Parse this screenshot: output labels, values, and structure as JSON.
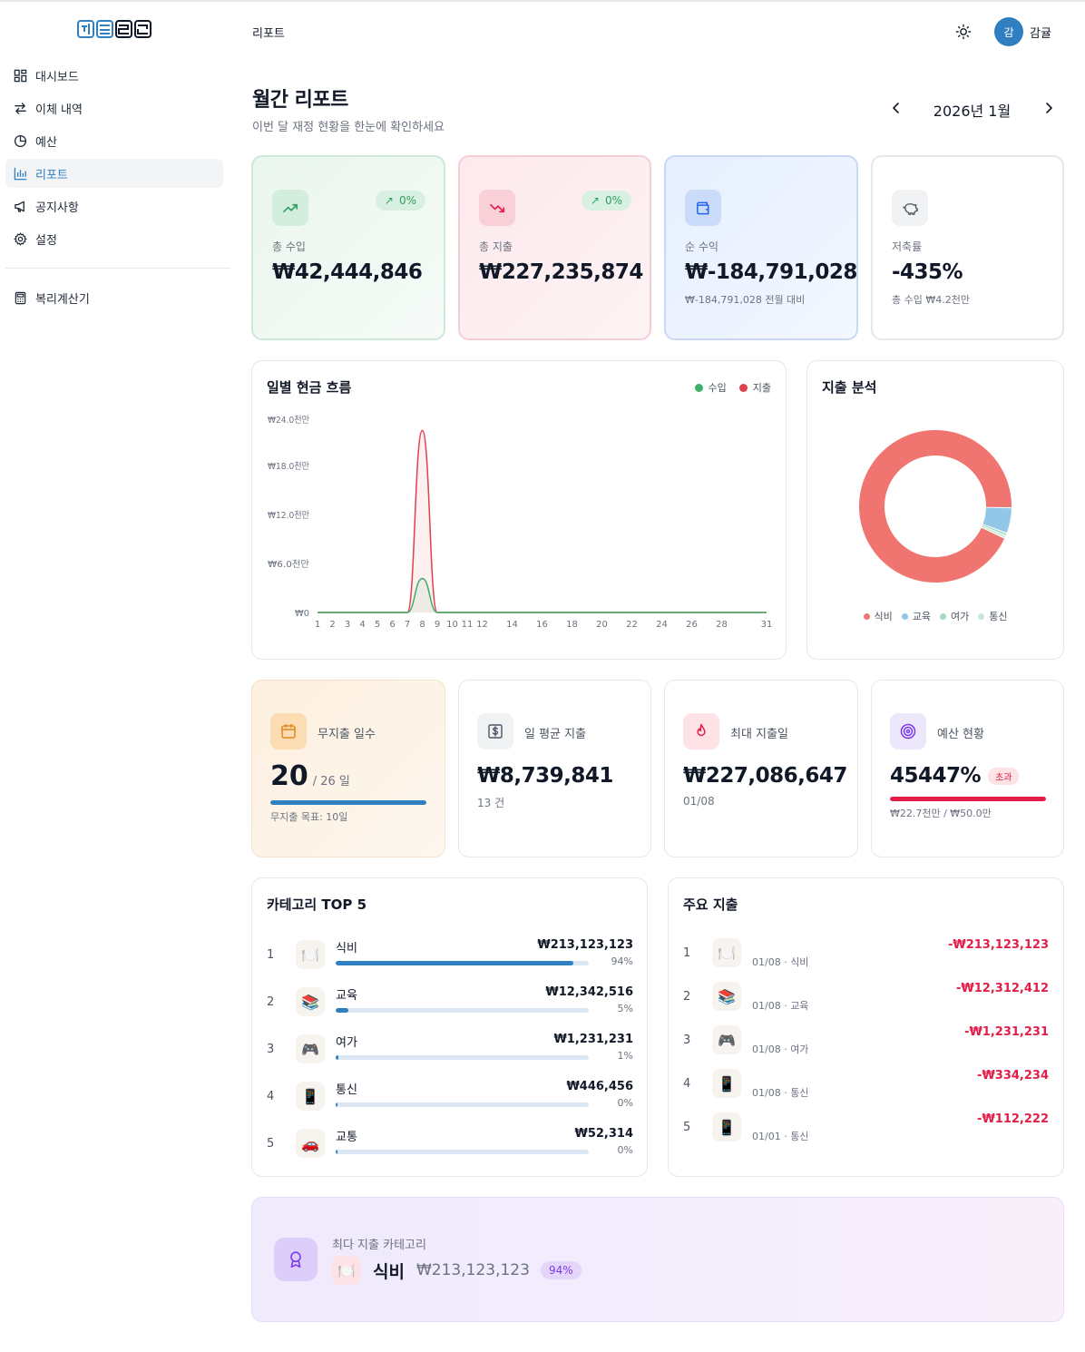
{
  "app": {
    "logo_text": "하루결산",
    "header_title": "리포트",
    "user_initial": "감",
    "user_name": "감귤"
  },
  "sidebar": {
    "items": [
      {
        "label": "대시보드",
        "icon": "dashboard-grid-icon"
      },
      {
        "label": "이체 내역",
        "icon": "transfer-arrows-icon"
      },
      {
        "label": "예산",
        "icon": "pie-chart-icon"
      },
      {
        "label": "리포트",
        "icon": "bar-chart-icon",
        "active": true
      },
      {
        "label": "공지사항",
        "icon": "megaphone-icon"
      },
      {
        "label": "설정",
        "icon": "gear-icon"
      }
    ],
    "tools": [
      {
        "label": "복리계산기",
        "icon": "calculator-icon"
      }
    ]
  },
  "page": {
    "title": "월간 리포트",
    "subtitle": "이번 달 재정 현황을 한눈에 확인하세요",
    "month_label": "2026년 1월"
  },
  "stats": {
    "income": {
      "label": "총 수입",
      "value": "₩42,444,846",
      "badge": "0%",
      "icon": "trending-up-icon"
    },
    "expense": {
      "label": "총 지출",
      "value": "₩227,235,874",
      "badge": "0%",
      "icon": "trending-down-icon"
    },
    "net": {
      "label": "순 수익",
      "value": "₩-184,791,028",
      "note": "₩-184,791,028 전월 대비",
      "icon": "wallet-icon"
    },
    "savings": {
      "label": "저축률",
      "value": "-435%",
      "note": "총 수입 ₩4.2천만",
      "icon": "piggy-bank-icon"
    }
  },
  "cashflow": {
    "title": "일별 현금 흐름",
    "legend": [
      "수입",
      "지출"
    ],
    "colors": {
      "income": "#3fae6a",
      "expense": "#e0414b"
    }
  },
  "chart_data": [
    {
      "type": "area",
      "title": "일별 현금 흐름",
      "x": [
        1,
        2,
        3,
        4,
        5,
        6,
        7,
        8,
        9,
        10,
        11,
        12,
        13,
        14,
        15,
        16,
        17,
        18,
        19,
        20,
        21,
        22,
        23,
        24,
        25,
        26,
        27,
        28,
        29,
        30,
        31
      ],
      "x_tick_labels": [
        "1",
        "2",
        "3",
        "4",
        "5",
        "6",
        "7",
        "8",
        "9",
        "10",
        "11",
        "12",
        "14",
        "16",
        "18",
        "20",
        "22",
        "24",
        "26",
        "28",
        "31"
      ],
      "y_tick_labels": [
        "₩0",
        "₩6.0천만",
        "₩18.0천만",
        "₩12.0천만",
        "₩24.0천만"
      ],
      "ylim": [
        0,
        240000000
      ],
      "series": [
        {
          "name": "수입",
          "color": "#3fae6a",
          "values": [
            0,
            0,
            0,
            0,
            0,
            0,
            0,
            42444846,
            0,
            0,
            0,
            0,
            0,
            0,
            0,
            0,
            0,
            0,
            0,
            0,
            0,
            0,
            0,
            0,
            0,
            0,
            0,
            0,
            0,
            0,
            0
          ]
        },
        {
          "name": "지출",
          "color": "#e0414b",
          "values": [
            0,
            0,
            0,
            0,
            0,
            0,
            0,
            227086647,
            0,
            0,
            0,
            0,
            0,
            0,
            0,
            0,
            0,
            0,
            0,
            0,
            0,
            0,
            0,
            0,
            0,
            0,
            0,
            0,
            0,
            0,
            0
          ]
        }
      ],
      "legend": "top-right",
      "grid": false
    },
    {
      "type": "pie",
      "title": "지출 분석",
      "categories": [
        "식비",
        "교육",
        "여가",
        "통신"
      ],
      "values": [
        213123123,
        12342516,
        1231231,
        446456
      ],
      "colors": [
        "#f0746f",
        "#93c7e8",
        "#a6d8bd",
        "#c3e8d3"
      ],
      "donut": true,
      "legend": "bottom"
    }
  ],
  "breakdown": {
    "title": "지출 분석",
    "legend": [
      {
        "label": "식비",
        "color": "#f0746f"
      },
      {
        "label": "교육",
        "color": "#93c7e8"
      },
      {
        "label": "여가",
        "color": "#a6d8bd"
      },
      {
        "label": "통신",
        "color": "#c3e8d3"
      }
    ]
  },
  "mini": {
    "no_spend": {
      "label": "무지출 일수",
      "value": "20",
      "suffix": "/ 26 일",
      "goal": "무지출 목표: 10일",
      "progress": 1.0,
      "icon": "calendar-icon"
    },
    "daily_avg": {
      "label": "일 평균 지출",
      "value": "₩8,739,841",
      "note": "13 건",
      "icon": "dollar-bill-icon"
    },
    "max_day": {
      "label": "최대 지출일",
      "value": "₩227,086,647",
      "note": "01/08",
      "icon": "flame-icon"
    },
    "budget": {
      "label": "예산 현황",
      "value": "45447%",
      "badge": "초과",
      "note": "₩22.7천만 / ₩50.0만",
      "progress": 1.0,
      "icon": "target-icon"
    }
  },
  "top5": {
    "title": "카테고리 TOP 5",
    "rows": [
      {
        "rank": "1",
        "emoji": "🍽️",
        "name": "식비",
        "amount": "₩213,123,123",
        "pct": "94%",
        "fraction": 0.94
      },
      {
        "rank": "2",
        "emoji": "📚",
        "name": "교육",
        "amount": "₩12,342,516",
        "pct": "5%",
        "fraction": 0.05
      },
      {
        "rank": "3",
        "emoji": "🎮",
        "name": "여가",
        "amount": "₩1,231,231",
        "pct": "1%",
        "fraction": 0.01
      },
      {
        "rank": "4",
        "emoji": "📱",
        "name": "통신",
        "amount": "₩446,456",
        "pct": "0%",
        "fraction": 0.0
      },
      {
        "rank": "5",
        "emoji": "🚗",
        "name": "교통",
        "amount": "₩52,314",
        "pct": "0%",
        "fraction": 0.0
      }
    ]
  },
  "major": {
    "title": "주요 지출",
    "rows": [
      {
        "rank": "1",
        "emoji": "🍽️",
        "meta": "01/08 · 식비",
        "amount": "-₩213,123,123"
      },
      {
        "rank": "2",
        "emoji": "📚",
        "meta": "01/08 · 교육",
        "amount": "-₩12,312,412"
      },
      {
        "rank": "3",
        "emoji": "🎮",
        "meta": "01/08 · 여가",
        "amount": "-₩1,231,231"
      },
      {
        "rank": "4",
        "emoji": "📱",
        "meta": "01/08 · 통신",
        "amount": "-₩334,234"
      },
      {
        "rank": "5",
        "emoji": "📱",
        "meta": "01/01 · 통신",
        "amount": "-₩112,222"
      }
    ]
  },
  "highlight": {
    "label": "최다 지출 카테고리",
    "emoji": "🍽️",
    "name": "식비",
    "amount": "₩213,123,123",
    "pct": "94%",
    "icon": "award-ribbon-icon"
  }
}
